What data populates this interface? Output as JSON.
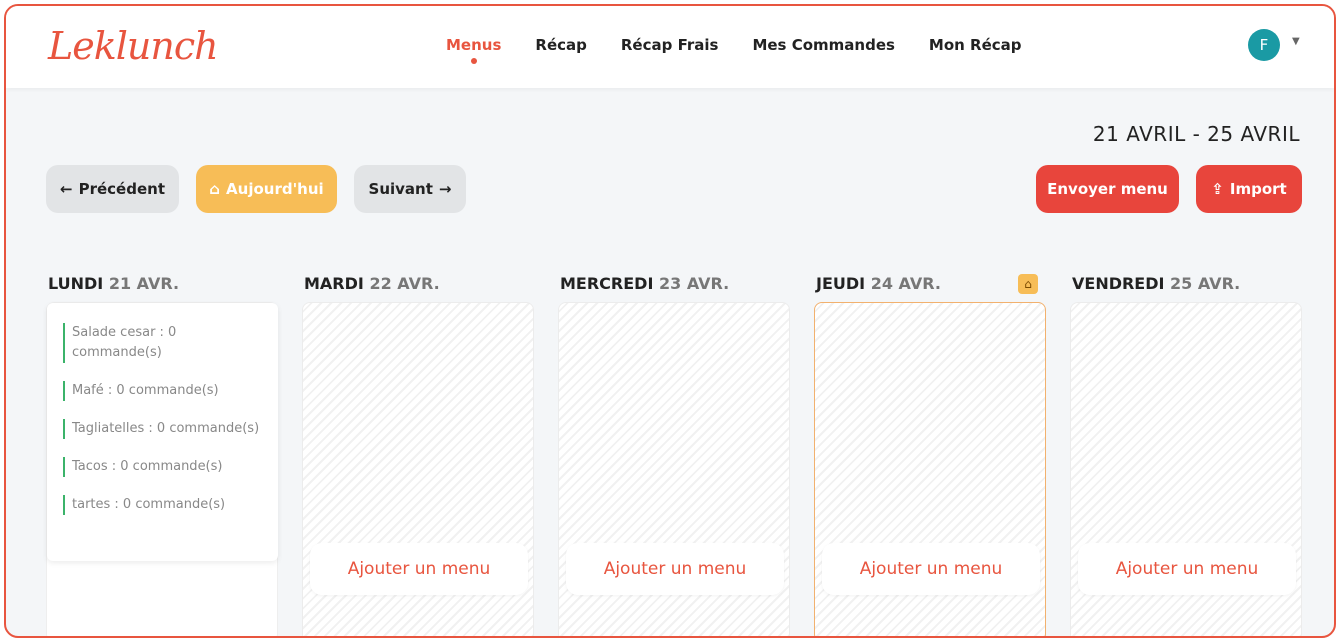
{
  "app": {
    "logo": "Leklunch"
  },
  "nav": [
    {
      "label": "Menus",
      "active": true
    },
    {
      "label": "Récap"
    },
    {
      "label": "Récap Frais"
    },
    {
      "label": "Mes Commandes"
    },
    {
      "label": "Mon Récap"
    }
  ],
  "user": {
    "initial": "F"
  },
  "week": {
    "range": "21 AVRIL - 25 AVRIL"
  },
  "buttons": {
    "prev": "Précédent",
    "today": "Aujourd'hui",
    "next": "Suivant",
    "send": "Envoyer menu",
    "import": "Import"
  },
  "days": [
    {
      "name": "LUNDI",
      "date": "21 AVR."
    },
    {
      "name": "MARDI",
      "date": "22 AVR."
    },
    {
      "name": "MERCREDI",
      "date": "23 AVR."
    },
    {
      "name": "JEUDI",
      "date": "24 AVR."
    },
    {
      "name": "VENDREDI",
      "date": "25 AVR."
    }
  ],
  "monday_menu": [
    "Salade cesar : 0 commande(s)",
    "Mafé : 0 commande(s)",
    "Tagliatelles : 0 commande(s)",
    "Tacos : 0 commande(s)",
    "tartes : 0 commande(s)"
  ],
  "add_menu_label": "Ajouter un menu",
  "colors": {
    "accent": "#e8553f",
    "today": "#f7bd57",
    "avatar": "#1a9aa4"
  }
}
